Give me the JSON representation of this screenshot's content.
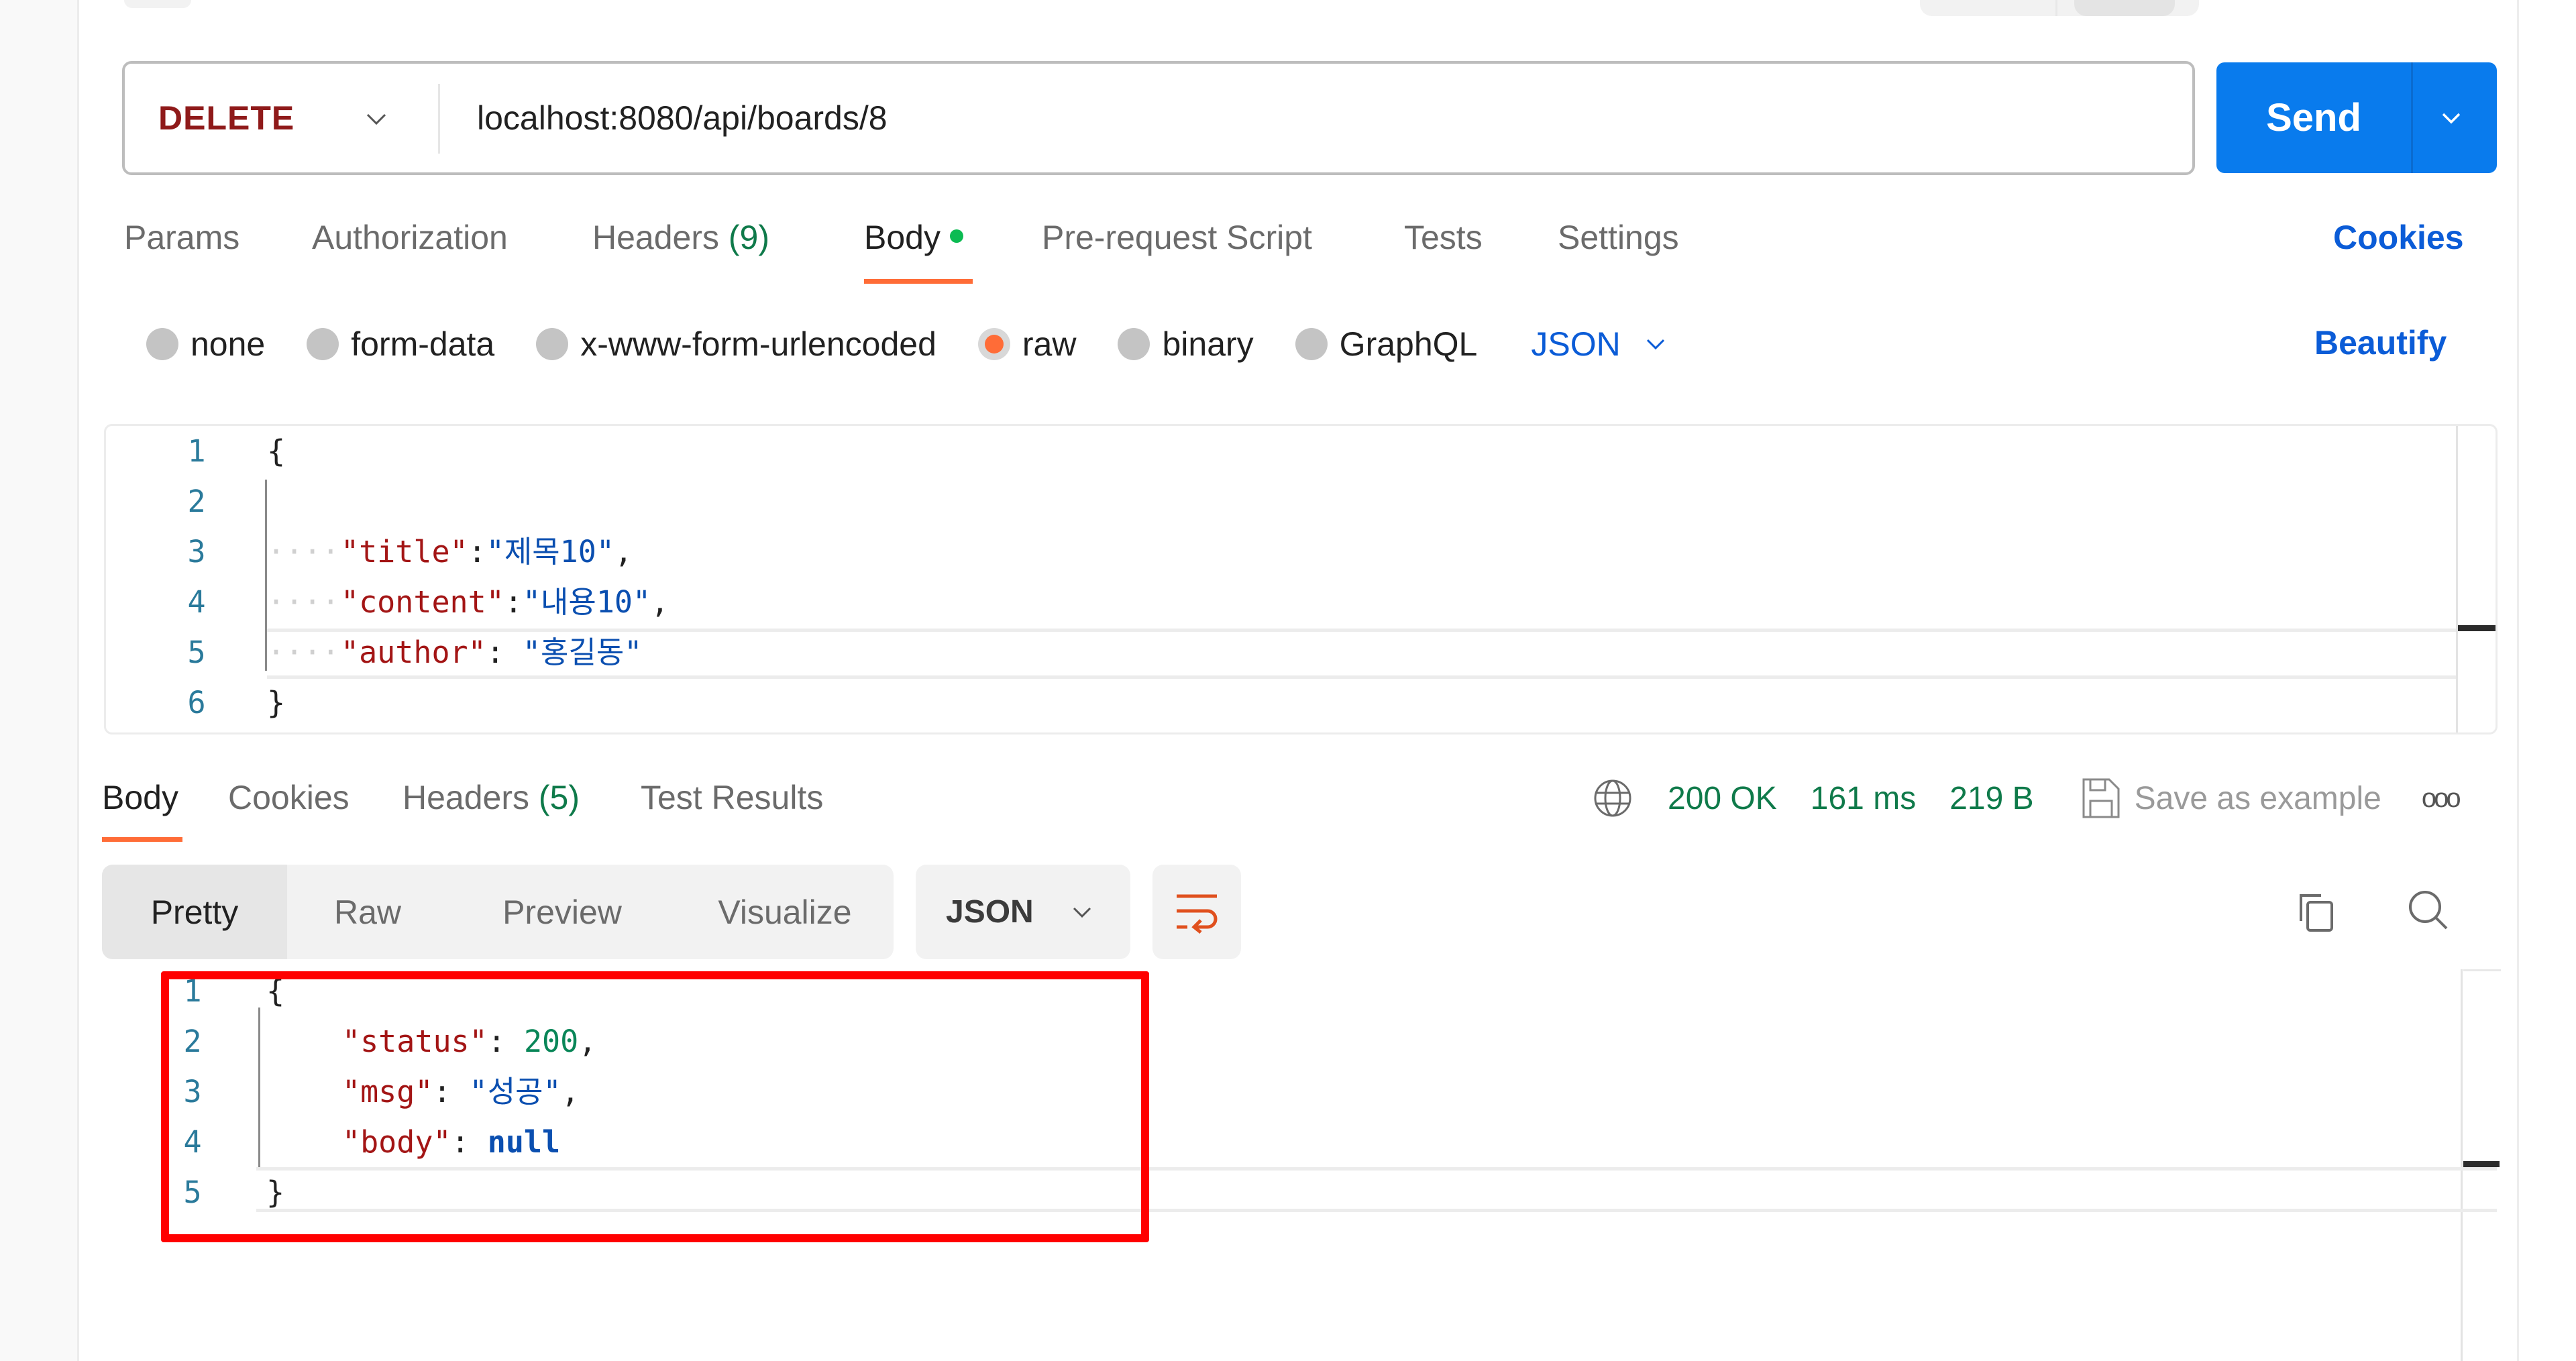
{
  "request": {
    "method": "DELETE",
    "url": "localhost:8080/api/boards/8",
    "send_label": "Send",
    "tabs": [
      {
        "label": "Params",
        "count": null
      },
      {
        "label": "Authorization",
        "count": null
      },
      {
        "label": "Headers",
        "count": "(9)"
      },
      {
        "label": "Body",
        "count": null,
        "active": true,
        "dot": true
      },
      {
        "label": "Pre-request Script",
        "count": null
      },
      {
        "label": "Tests",
        "count": null
      },
      {
        "label": "Settings",
        "count": null
      }
    ],
    "cookies_link": "Cookies",
    "body_types": [
      "none",
      "form-data",
      "x-www-form-urlencoded",
      "raw",
      "binary",
      "GraphQL"
    ],
    "body_type_selected": "raw",
    "format": "JSON",
    "beautify_label": "Beautify",
    "body_lines": [
      {
        "n": "1",
        "text": "{"
      },
      {
        "n": "2",
        "text": ""
      },
      {
        "n": "3",
        "key": "\"title\"",
        "sep": ":",
        "value": "\"제목10\"",
        "trail": ","
      },
      {
        "n": "4",
        "key": "\"content\"",
        "sep": ":",
        "value": "\"내용10\"",
        "trail": ","
      },
      {
        "n": "5",
        "key": "\"author\"",
        "sep": ": ",
        "value": "\"홍길동\"",
        "trail": ""
      },
      {
        "n": "6",
        "text": "}"
      }
    ]
  },
  "response": {
    "tabs": [
      {
        "label": "Body",
        "active": true
      },
      {
        "label": "Cookies"
      },
      {
        "label": "Headers",
        "count": "(5)"
      },
      {
        "label": "Test Results"
      }
    ],
    "status": "200 OK",
    "time": "161 ms",
    "size": "219 B",
    "save_example_label": "Save as example",
    "more_label": "ooo",
    "view_modes": [
      "Pretty",
      "Raw",
      "Preview",
      "Visualize"
    ],
    "view_mode_selected": "Pretty",
    "format": "JSON",
    "body_lines": [
      {
        "n": "1",
        "text": "{"
      },
      {
        "n": "2",
        "key": "\"status\"",
        "sep": ": ",
        "value": "200",
        "vtype": "num",
        "trail": ","
      },
      {
        "n": "3",
        "key": "\"msg\"",
        "sep": ": ",
        "value": "\"성공\"",
        "vtype": "str",
        "trail": ","
      },
      {
        "n": "4",
        "key": "\"body\"",
        "sep": ": ",
        "value": "null",
        "vtype": "null",
        "trail": ""
      },
      {
        "n": "5",
        "text": "}"
      }
    ]
  },
  "colors": {
    "accent_send": "#097bed",
    "method_delete": "#8f1a1a",
    "tab_underline": "#ff6c37",
    "status_ok": "#0f7a4a",
    "link_blue": "#0b5cd7",
    "highlight_box": "#ff0000"
  }
}
